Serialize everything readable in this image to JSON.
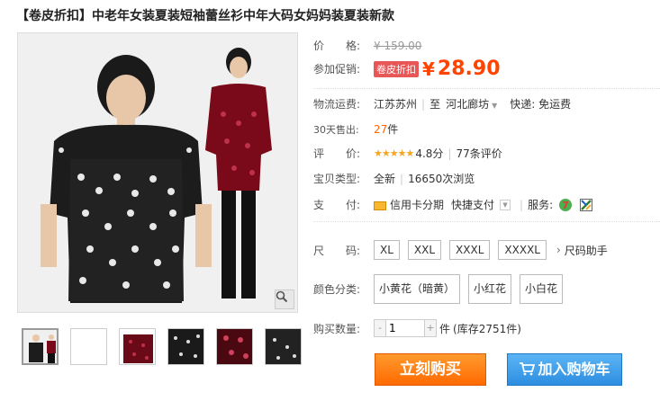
{
  "product": {
    "title_tag": "【卷皮折扣】",
    "title": "中老年女装夏装短袖蕾丝衫中年大码女妈妈装夏装新款"
  },
  "price": {
    "label": "价　　格:",
    "original": "¥ 159.00",
    "promo_label": "参加促销:",
    "promo_tag": "卷皮折扣",
    "yen": "¥",
    "current": "28.90"
  },
  "shipping": {
    "label": "物流运费:",
    "from": "江苏苏州",
    "to_prefix": "至",
    "to": "河北廊坊",
    "express": "快递: 免运费"
  },
  "sales": {
    "label": "30天售出:",
    "count": "27",
    "unit": "件"
  },
  "rating": {
    "label": "评　　价:",
    "stars": "★★★★★",
    "score": "4.8分",
    "reviews": "77条评价"
  },
  "type": {
    "label": "宝贝类型:",
    "value": "全新",
    "views": "16650次浏览"
  },
  "payment": {
    "label": "支　　付:",
    "credit": "信用卡分期",
    "quick": "快捷支付",
    "service_label": "服务:"
  },
  "size": {
    "label": "尺　　码:",
    "options": [
      "XL",
      "XXL",
      "XXXL",
      "XXXXL"
    ],
    "helper": "尺码助手"
  },
  "color": {
    "label": "颜色分类:",
    "options": [
      "小黄花（暗黄）",
      "小红花",
      "小白花"
    ]
  },
  "quantity": {
    "label": "购买数量:",
    "value": "1",
    "minus": "-",
    "plus": "+",
    "unit": "件",
    "stock": "(库存2751件)"
  },
  "actions": {
    "buy": "立刻购买",
    "cart": "加入购物车"
  },
  "colors": {
    "accent": "#ff4400",
    "buy_button": "#ff6a00",
    "cart_button": "#2d8ee0"
  }
}
